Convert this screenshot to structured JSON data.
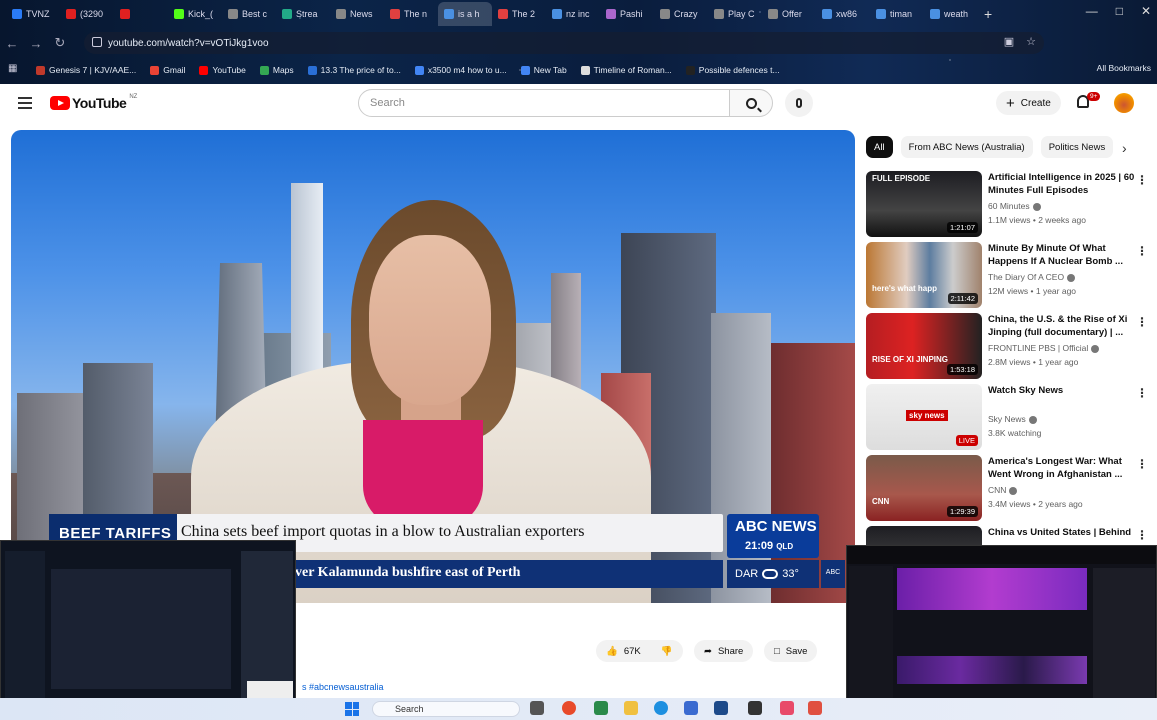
{
  "browser": {
    "tabs": [
      {
        "label": "TVNZ",
        "color": "#2a7bf6"
      },
      {
        "label": "(3290",
        "color": "#e02020"
      },
      {
        "label": "",
        "color": "#e02020"
      },
      {
        "label": "Kick_(",
        "color": "#53fc18"
      },
      {
        "label": "Best c",
        "color": "#888888"
      },
      {
        "label": "Strea",
        "color": "#22aa88"
      },
      {
        "label": "News",
        "color": "#888888"
      },
      {
        "label": "The n",
        "color": "#e04040"
      },
      {
        "label": "is a h",
        "color": "#4a90e2"
      },
      {
        "label": "The 2",
        "color": "#e04040"
      },
      {
        "label": "nz inc",
        "color": "#4a90e2"
      },
      {
        "label": "Pashi",
        "color": "#aa66cc"
      },
      {
        "label": "Crazy",
        "color": "#888888"
      },
      {
        "label": "Play C",
        "color": "#888888"
      },
      {
        "label": "Offer",
        "color": "#888888"
      },
      {
        "label": "xw86",
        "color": "#4a90e2"
      },
      {
        "label": "timan",
        "color": "#4a90e2"
      },
      {
        "label": "weath",
        "color": "#4a90e2"
      }
    ],
    "url": "youtube.com/watch?v=vOTiJkg1voo",
    "bookmarks": [
      {
        "label": "Genesis 7 | KJV/AAE...",
        "color": "#c0392b"
      },
      {
        "label": "Gmail",
        "color": "#ea4335"
      },
      {
        "label": "YouTube",
        "color": "#ff0000"
      },
      {
        "label": "Maps",
        "color": "#34a853"
      },
      {
        "label": "13.3 The price of to...",
        "color": "#2a6fd6"
      },
      {
        "label": "x3500 m4 how to u...",
        "color": "#4285f4"
      },
      {
        "label": "New Tab",
        "color": "#4285f4"
      },
      {
        "label": "Timeline of Roman...",
        "color": "#dddddd"
      },
      {
        "label": "Possible defences t...",
        "color": "#222222"
      }
    ],
    "all_bookmarks": "All Bookmarks"
  },
  "yt": {
    "logo_text": "YouTube",
    "region": "NZ",
    "search_placeholder": "Search",
    "create_label": "Create",
    "notif_count": "9+"
  },
  "video": {
    "topic": "BEEF TARIFFS",
    "headline": "China sets beef import quotas in a blow to Australian exporters",
    "ticker": "ver Kalamunda bushfire east of Perth",
    "network": "ABC NEWS",
    "time": "21:09",
    "tz": "QLD",
    "weather_city": "DAR",
    "weather_temp": "33°",
    "logo_small": "ABC"
  },
  "chips": [
    "All",
    "From ABC News (Australia)",
    "Politics News"
  ],
  "recs": [
    {
      "title": "Artificial Intelligence in 2025 | 60 Minutes Full Episodes",
      "channel": "60 Minutes",
      "meta": "1.1M views • 2 weeks ago",
      "duration": "1:21:07",
      "thumb_label": "FULL EPISODE"
    },
    {
      "title": "Minute By Minute Of What Happens If A Nuclear Bomb ...",
      "channel": "The Diary Of A CEO",
      "meta": "12M views • 1 year ago",
      "duration": "2:11:42",
      "thumb_label": "here's what happ"
    },
    {
      "title": "China, the U.S. & the Rise of Xi Jinping (full documentary) | ...",
      "channel": "FRONTLINE PBS | Official",
      "meta": "2.8M views • 1 year ago",
      "duration": "1:53:18",
      "thumb_label": "RISE OF XI JINPING"
    },
    {
      "title": "Watch Sky News",
      "channel": "Sky News",
      "meta": "3.8K watching",
      "duration": "LIVE",
      "thumb_label": "sky news"
    },
    {
      "title": "America's Longest War: What Went Wrong in Afghanistan ...",
      "channel": "CNN",
      "meta": "3.4M views • 2 years ago",
      "duration": "1:29:39",
      "thumb_label": "CNN"
    },
    {
      "title": "China vs United States | Behind",
      "channel": "",
      "meta": "",
      "duration": "",
      "thumb_label": ""
    }
  ],
  "actions": {
    "likes": "67K",
    "share": "Share",
    "save": "Save"
  },
  "hashtag": "s #abcnewsaustralia",
  "taskbar": {
    "search": "Search"
  }
}
